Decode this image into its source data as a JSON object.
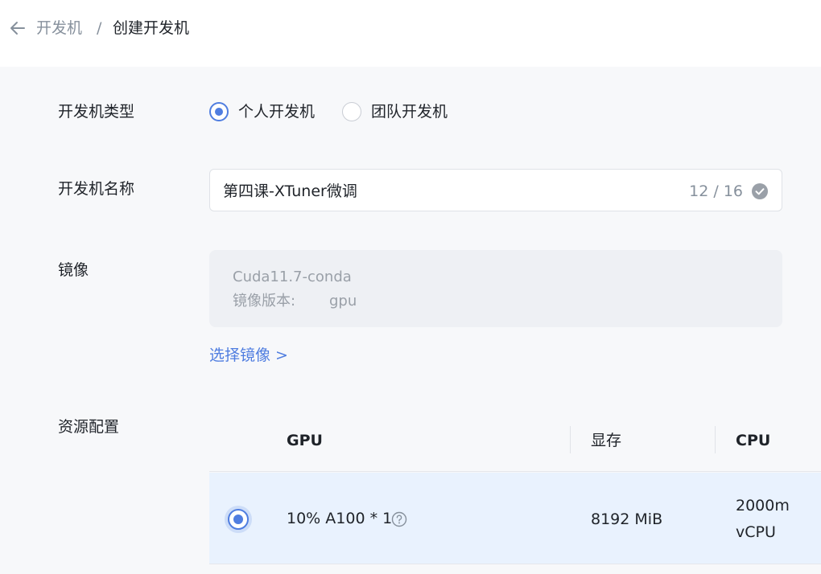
{
  "breadcrumb": {
    "parent": "开发机",
    "separator": "/",
    "current": "创建开发机"
  },
  "form": {
    "type_label": "开发机类型",
    "type_options": [
      {
        "label": "个人开发机",
        "selected": true
      },
      {
        "label": "团队开发机",
        "selected": false
      }
    ],
    "name_label": "开发机名称",
    "name_value": "第四课-XTuner微调",
    "name_count": "12 / 16",
    "image_label": "镜像",
    "image_name": "Cuda11.7-conda",
    "image_version_label": "镜像版本:",
    "image_version_value": "gpu",
    "select_image_link": "选择镜像 >",
    "resource_label": "资源配置"
  },
  "resource_table": {
    "headers": [
      "GPU",
      "显存",
      "CPU"
    ],
    "rows": [
      {
        "selected": true,
        "gpu": "10% A100 * 1",
        "memory": "8192 MiB",
        "cpu_line1": "2000m",
        "cpu_line2": "vCPU"
      }
    ]
  },
  "colors": {
    "accent": "#4f7de0",
    "selected_row": "#e9f2fe",
    "page_background": "#f7f8fa"
  },
  "icons": {
    "back": "arrow-left-icon",
    "valid": "check-circle-icon",
    "help": "question-circle-icon"
  }
}
